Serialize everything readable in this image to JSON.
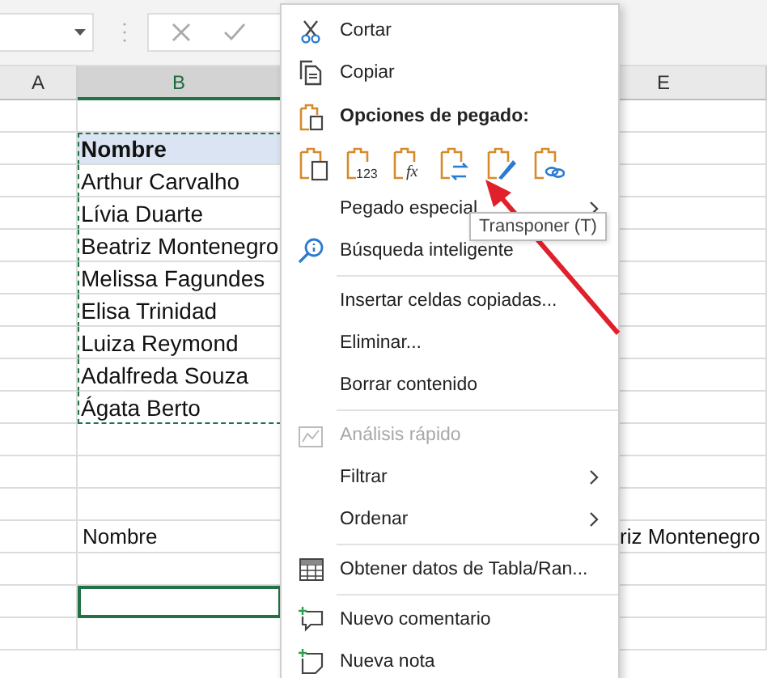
{
  "formula_bar": {
    "buttons": [
      {
        "kind": "cancel"
      },
      {
        "kind": "enter"
      }
    ]
  },
  "columns": [
    {
      "label": "A",
      "selected": false
    },
    {
      "label": "B",
      "selected": true
    },
    {
      "label": "E",
      "selected": false
    }
  ],
  "rows": [
    {
      "kind": "plain",
      "copied": false,
      "active": false
    },
    {
      "b": "Nombre",
      "kind": "header",
      "copied": true,
      "active": false
    },
    {
      "b": "Arthur Carvalho",
      "kind": "plain",
      "copied": true,
      "active": false
    },
    {
      "b": "Lívia Duarte",
      "kind": "plain",
      "copied": true,
      "active": false
    },
    {
      "b": "Beatriz Montenegro",
      "kind": "plain",
      "copied": true,
      "active": false
    },
    {
      "b": "Melissa Fagundes",
      "kind": "plain",
      "copied": true,
      "active": false
    },
    {
      "b": "Elisa Trinidad",
      "kind": "plain",
      "copied": true,
      "active": false
    },
    {
      "b": "Luiza Reymond",
      "kind": "plain",
      "copied": true,
      "active": false
    },
    {
      "b": "Adalfreda Souza",
      "kind": "plain",
      "copied": true,
      "active": false
    },
    {
      "b": "Ágata Berto",
      "kind": "plain",
      "copied": true,
      "active": false
    },
    {
      "kind": "plain",
      "copied": false,
      "active": false
    },
    {
      "kind": "plain",
      "copied": false,
      "active": false
    },
    {
      "kind": "plain",
      "copied": false,
      "active": false
    },
    {
      "b": "Nombre",
      "e": "riz Montenegro",
      "kind": "small",
      "copied": false,
      "active": false
    },
    {
      "kind": "plain",
      "copied": false,
      "active": false
    },
    {
      "kind": "plain",
      "copied": false,
      "active": true
    },
    {
      "kind": "plain",
      "copied": false,
      "active": false
    }
  ],
  "context_menu": {
    "items": [
      {
        "kind": "cut",
        "label": "Cortar",
        "disabled": false,
        "submenu": false,
        "divider_above": false
      },
      {
        "kind": "copy",
        "label": "Copiar",
        "disabled": false,
        "submenu": false,
        "divider_above": false
      },
      {
        "kind": "paste-header",
        "label": "Opciones de pegado:",
        "disabled": false,
        "submenu": false,
        "divider_above": false
      },
      {
        "kind": "paste-icons",
        "options": [
          {
            "kind": "paste"
          },
          {
            "kind": "values",
            "badge": "123"
          },
          {
            "kind": "formulas",
            "badge": "fx"
          },
          {
            "kind": "transpose"
          },
          {
            "kind": "formatting"
          },
          {
            "kind": "link"
          }
        ]
      },
      {
        "kind": "plain",
        "label": "Pegado especial",
        "disabled": false,
        "submenu": true,
        "divider_above": false
      },
      {
        "kind": "lookup",
        "label": "Búsqueda inteligente",
        "disabled": false,
        "submenu": false,
        "divider_above": false
      },
      {
        "kind": "plain",
        "label": "Insertar celdas copiadas...",
        "disabled": false,
        "submenu": false,
        "divider_above": true
      },
      {
        "kind": "plain",
        "label": "Eliminar...",
        "disabled": false,
        "submenu": false,
        "divider_above": false
      },
      {
        "kind": "plain",
        "label": "Borrar contenido",
        "disabled": false,
        "submenu": false,
        "divider_above": false
      },
      {
        "kind": "quick",
        "label": "Análisis rápido",
        "disabled": true,
        "submenu": false,
        "divider_above": true
      },
      {
        "kind": "plain",
        "label": "Filtrar",
        "disabled": false,
        "submenu": true,
        "divider_above": false
      },
      {
        "kind": "plain",
        "label": "Ordenar",
        "disabled": false,
        "submenu": true,
        "divider_above": false
      },
      {
        "kind": "table",
        "label": "Obtener datos de Tabla/Ran...",
        "disabled": false,
        "submenu": false,
        "divider_above": true
      },
      {
        "kind": "comment",
        "label": "Nuevo comentario",
        "disabled": false,
        "submenu": false,
        "divider_above": true
      },
      {
        "kind": "note",
        "label": "Nueva nota",
        "disabled": false,
        "submenu": false,
        "divider_above": false
      }
    ]
  },
  "tooltip": {
    "text": "Transponer (T)"
  }
}
